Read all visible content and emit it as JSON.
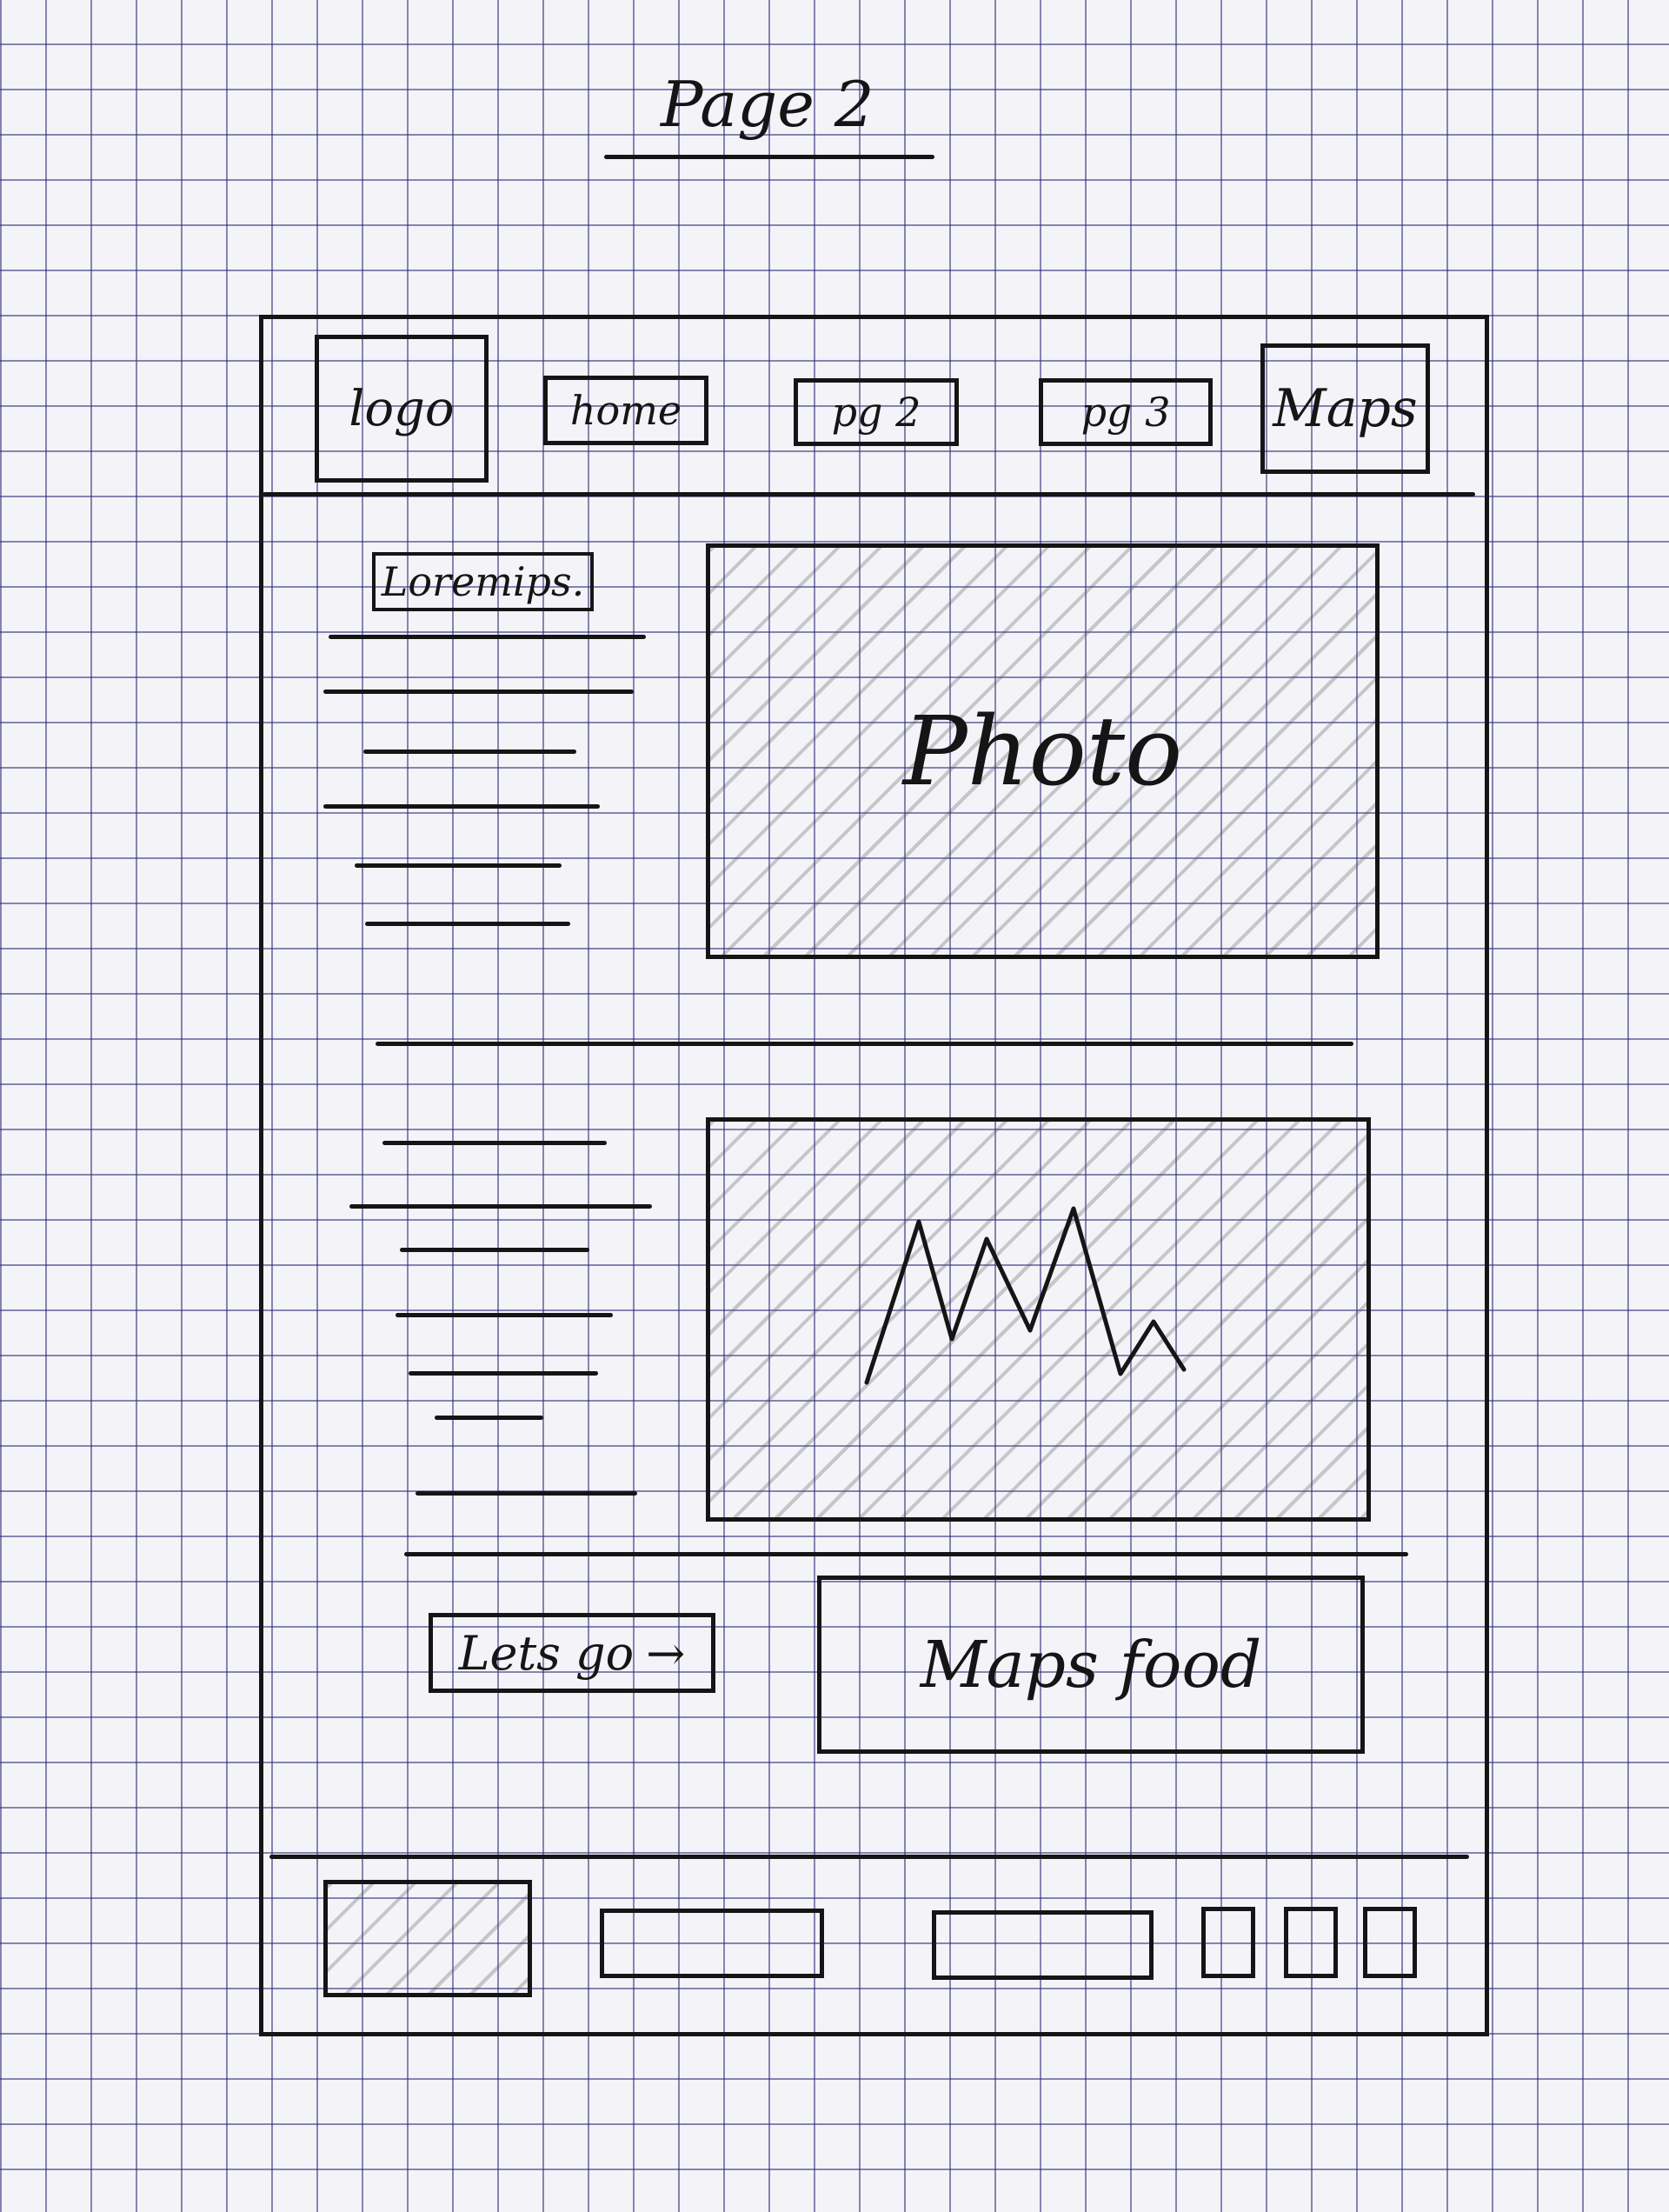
{
  "page_title": "Page 2",
  "nav": {
    "logo": "logo",
    "items": [
      "home",
      "pg 2",
      "pg 3",
      "Maps"
    ]
  },
  "content": {
    "heading": "Loremips.",
    "photo_label": "Photo",
    "cta_label": "Lets go",
    "cta_arrow": "→",
    "maps_label": "Maps food"
  }
}
